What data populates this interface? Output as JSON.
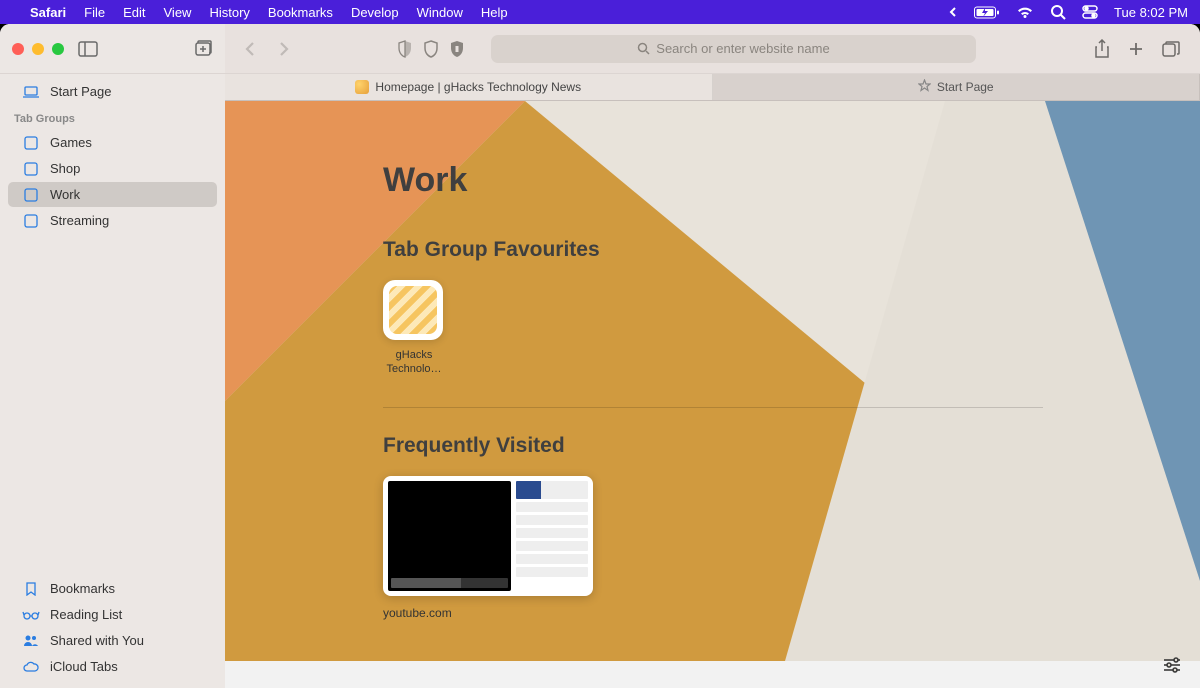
{
  "menubar": {
    "app_name": "Safari",
    "items": [
      "File",
      "Edit",
      "View",
      "History",
      "Bookmarks",
      "Develop",
      "Window",
      "Help"
    ],
    "clock": "Tue  8:02 PM"
  },
  "toolbar": {
    "search_placeholder": "Search or enter website name"
  },
  "sidebar": {
    "start_page_label": "Start Page",
    "tab_groups_header": "Tab Groups",
    "groups": [
      {
        "label": "Games"
      },
      {
        "label": "Shop"
      },
      {
        "label": "Work"
      },
      {
        "label": "Streaming"
      }
    ],
    "selected_group_index": 2,
    "bottom": {
      "bookmarks": "Bookmarks",
      "reading_list": "Reading List",
      "shared": "Shared with You",
      "icloud": "iCloud Tabs"
    }
  },
  "tabs": [
    {
      "label": "Homepage | gHacks Technology News",
      "active": true,
      "has_favicon": true
    },
    {
      "label": "Start Page",
      "active": false,
      "has_star": true
    }
  ],
  "startpage": {
    "title": "Work",
    "favourites_header": "Tab Group Favourites",
    "favourites": [
      {
        "label": "gHacks Technolo…"
      }
    ],
    "frequently_header": "Frequently Visited",
    "frequently": [
      {
        "label": "youtube.com"
      }
    ]
  }
}
